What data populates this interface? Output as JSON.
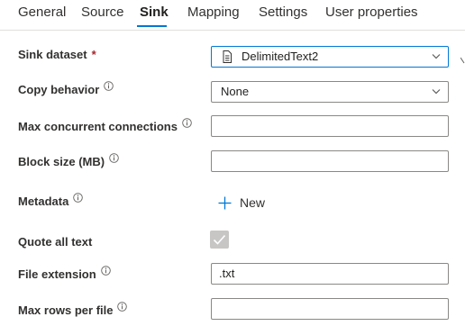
{
  "tabs": [
    {
      "label": "General"
    },
    {
      "label": "Source"
    },
    {
      "label": "Sink"
    },
    {
      "label": "Mapping"
    },
    {
      "label": "Settings"
    },
    {
      "label": "User properties"
    }
  ],
  "active_tab": "Sink",
  "form": {
    "sink_dataset": {
      "label": "Sink dataset",
      "required_mark": "*",
      "value": "DelimitedText2"
    },
    "copy_behavior": {
      "label": "Copy behavior",
      "value": "None"
    },
    "max_concurrent_connections": {
      "label": "Max concurrent connections",
      "value": ""
    },
    "block_size": {
      "label": "Block size (MB)",
      "value": ""
    },
    "metadata": {
      "label": "Metadata",
      "new_label": "New"
    },
    "quote_all_text": {
      "label": "Quote all text",
      "checked": true
    },
    "file_extension": {
      "label": "File extension",
      "value": ".txt"
    },
    "max_rows_per_file": {
      "label": "Max rows per file",
      "value": ""
    }
  },
  "colors": {
    "accent": "#0078d4",
    "required": "#a4262c",
    "disabled_checkbox": "#c8c6c4"
  }
}
